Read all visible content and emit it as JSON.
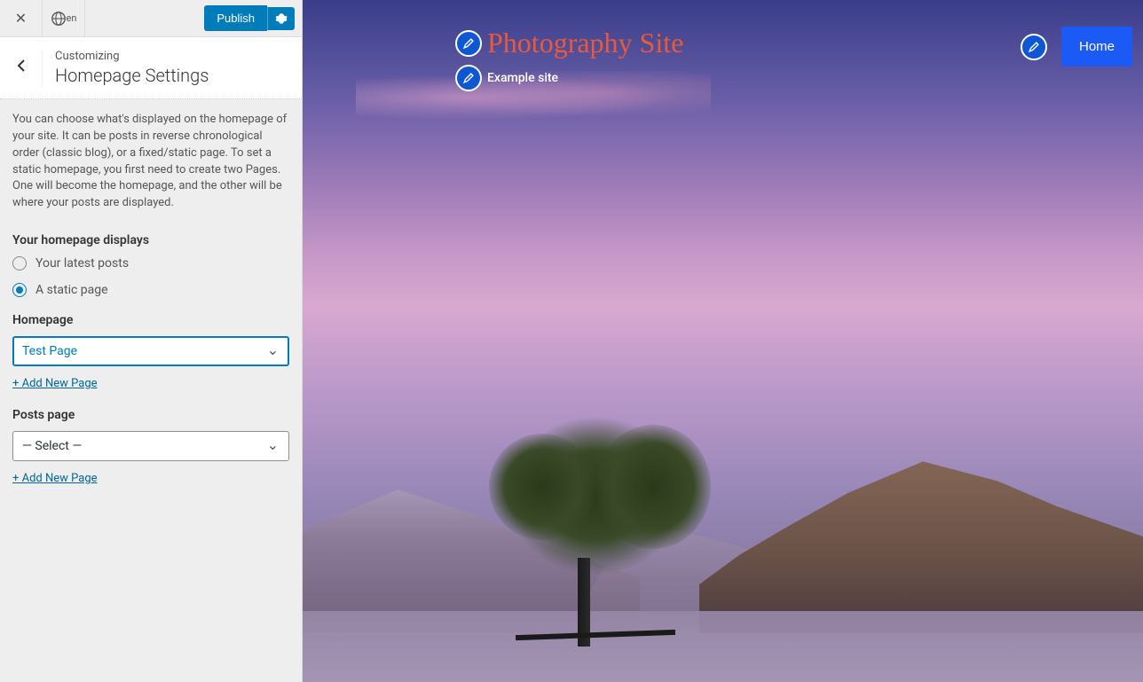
{
  "topbar": {
    "lang_code": "en",
    "publish_label": "Publish"
  },
  "header": {
    "customizing_label": "Customizing",
    "panel_title": "Homepage Settings"
  },
  "description": "You can choose what's displayed on the homepage of your site. It can be posts in reverse chronological order (classic blog), or a fixed/static page. To set a static homepage, you first need to create two Pages. One will become the homepage, and the other will be where your posts are displayed.",
  "homepage_displays": {
    "label": "Your homepage displays",
    "options": {
      "latest_posts": "Your latest posts",
      "static_page": "A static page"
    },
    "selected": "static_page"
  },
  "homepage_select": {
    "label": "Homepage",
    "value": "Test Page",
    "add_link": "+ Add New Page"
  },
  "posts_page_select": {
    "label": "Posts page",
    "value": "— Select —",
    "add_link": "+ Add New Page"
  },
  "preview": {
    "site_title": "Photography Site",
    "tagline": "Example site",
    "nav_home": "Home"
  }
}
